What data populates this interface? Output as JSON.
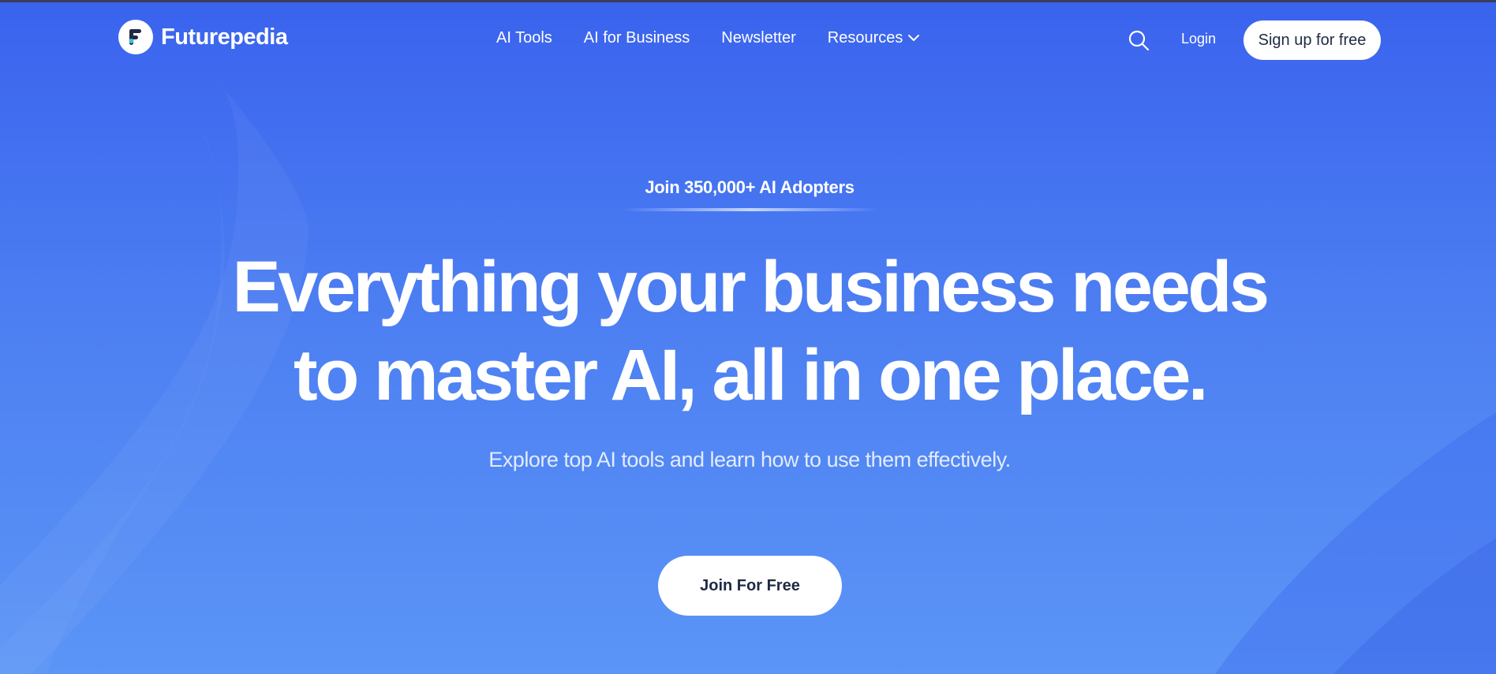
{
  "brand": {
    "name": "Futurepedia",
    "logo_icon": "futurepedia-f-logo",
    "logo_colors": [
      "#1f2a44",
      "#3ec1e6"
    ]
  },
  "nav": {
    "links": [
      {
        "label": "AI Tools"
      },
      {
        "label": "AI for Business"
      },
      {
        "label": "Newsletter"
      },
      {
        "label": "Resources",
        "icon": "chevron-down-icon"
      }
    ],
    "search_icon": "search-icon",
    "login_label": "Login",
    "signup_label": "Sign up for free"
  },
  "hero": {
    "eyebrow": "Join 350,000+ AI Adopters",
    "headline_line1": "Everything your business needs",
    "headline_line2": "to master AI, all in one place.",
    "subheadline": "Explore top AI tools and learn how to use them effectively.",
    "cta_label": "Join For Free"
  },
  "colors": {
    "background_top": "#3a63ee",
    "background_bottom": "#5b95f6",
    "button_bg": "#ffffff",
    "button_text": "#1f2a44",
    "text": "#ffffff"
  }
}
